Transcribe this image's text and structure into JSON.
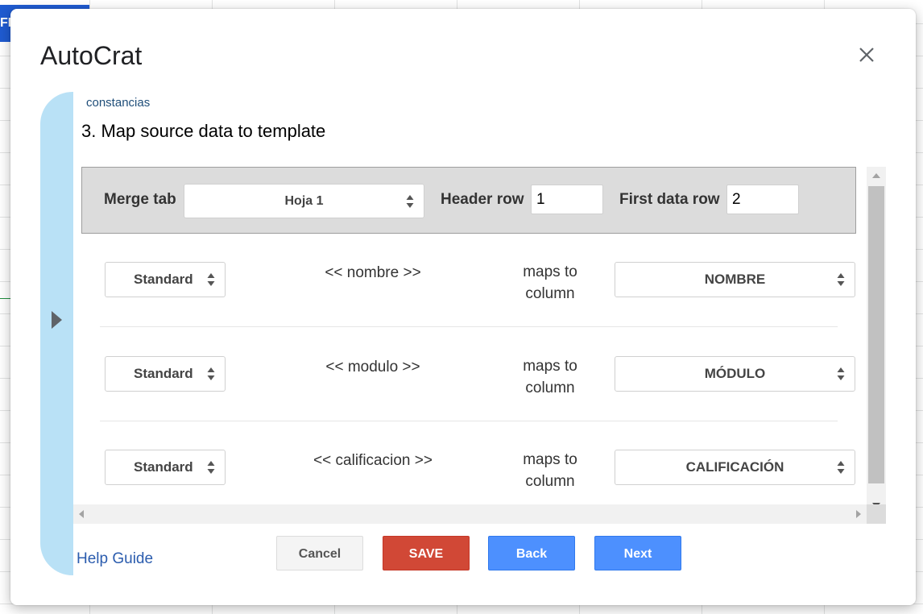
{
  "background": {
    "tab_label": "FIC"
  },
  "dialog": {
    "title": "AutoCrat",
    "project_name": "constancias",
    "step_title": "3. Map source data to template"
  },
  "merge": {
    "merge_tab_label": "Merge tab",
    "merge_tab_value": "Hoja 1",
    "header_row_label": "Header row",
    "header_row_value": "1",
    "first_data_row_label": "First data row",
    "first_data_row_value": "2"
  },
  "mappings": [
    {
      "type": "Standard",
      "tag": "<< nombre >>",
      "maps_to_line1": "maps to",
      "maps_to_line2": "column",
      "column": "NOMBRE"
    },
    {
      "type": "Standard",
      "tag": "<< modulo >>",
      "maps_to_line1": "maps to",
      "maps_to_line2": "column",
      "column": "MÓDULO"
    },
    {
      "type": "Standard",
      "tag": "<< calificacion >>",
      "maps_to_line1": "maps to",
      "maps_to_line2": "column",
      "column": "CALIFICACIÓN"
    }
  ],
  "footer": {
    "help_guide": "Help Guide",
    "cancel": "Cancel",
    "save": "SAVE",
    "back": "Back",
    "next": "Next"
  },
  "colors": {
    "side_tab": "#b9e1f6",
    "save_button": "#d14836",
    "nav_button": "#4d90fe",
    "sheet_tab": "#1f5bd1"
  },
  "icons": {
    "close": "close-icon",
    "expand": "triangle-right-icon",
    "select": "up-down-arrows-icon"
  }
}
